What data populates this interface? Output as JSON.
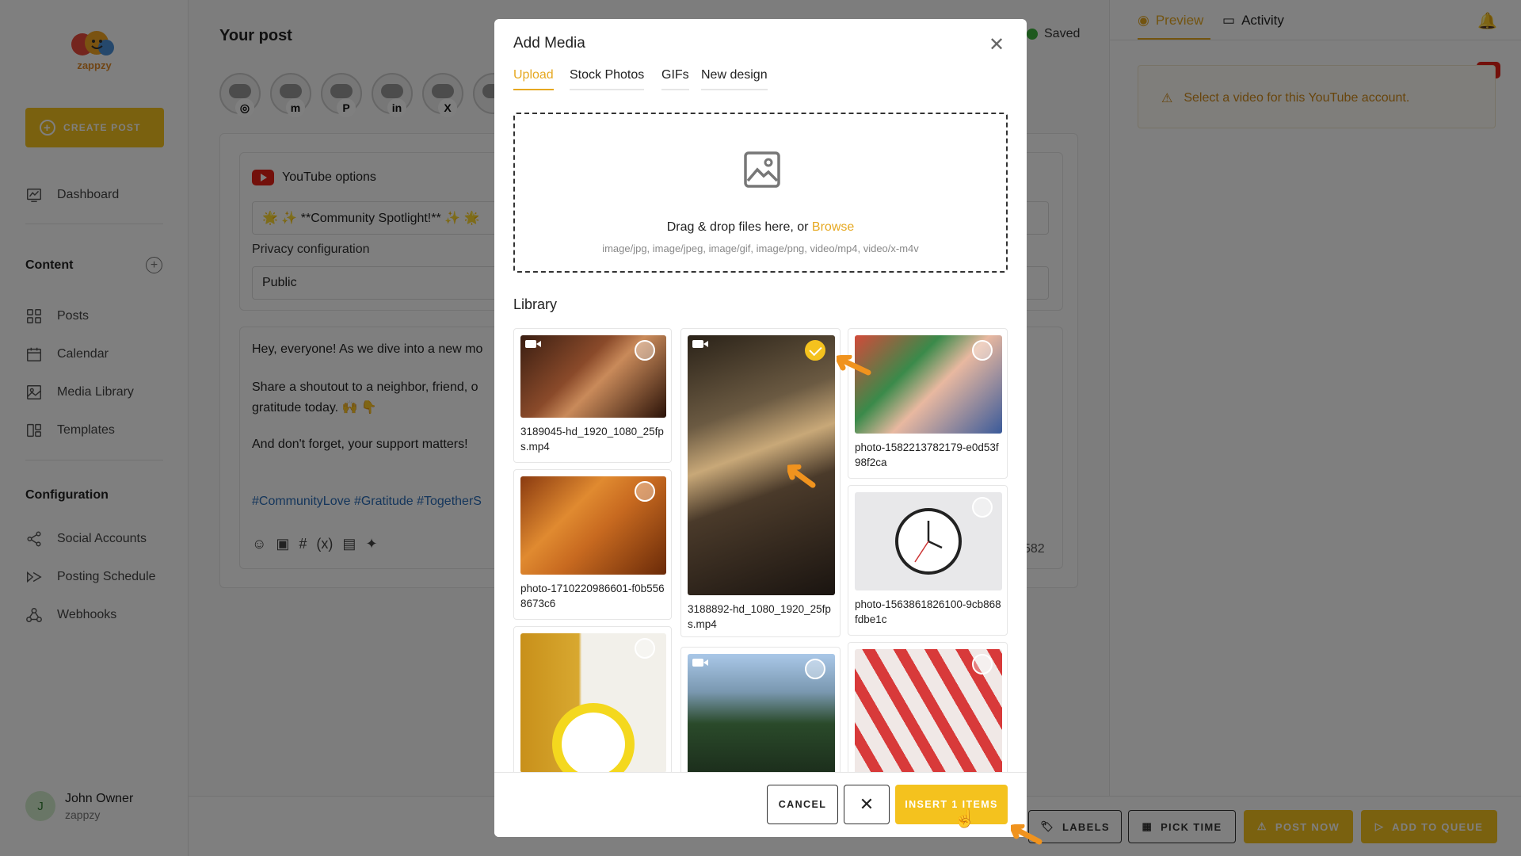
{
  "sidebar": {
    "logo_text": "zappzy",
    "create_post": "CREATE POST",
    "nav_top": [
      {
        "label": "Dashboard",
        "icon": "dashboard-icon"
      }
    ],
    "content_title": "Content",
    "content_items": [
      {
        "label": "Posts",
        "icon": "grid-icon"
      },
      {
        "label": "Calendar",
        "icon": "calendar-icon"
      },
      {
        "label": "Media Library",
        "icon": "image-icon"
      },
      {
        "label": "Templates",
        "icon": "template-icon"
      }
    ],
    "config_title": "Configuration",
    "config_items": [
      {
        "label": "Social Accounts",
        "icon": "share-icon"
      },
      {
        "label": "Posting Schedule",
        "icon": "schedule-icon"
      },
      {
        "label": "Webhooks",
        "icon": "webhook-icon"
      }
    ],
    "user": {
      "initial": "J",
      "name": "John Owner",
      "org": "zappzy"
    }
  },
  "main": {
    "title": "Your post",
    "saved": "Saved",
    "accounts": [
      {
        "network": "Instagram",
        "badge": "◎"
      },
      {
        "network": "Mastodon",
        "badge": "m"
      },
      {
        "network": "Pinterest",
        "badge": "P"
      },
      {
        "network": "LinkedIn",
        "badge": "in"
      },
      {
        "network": "X",
        "badge": "X"
      }
    ],
    "youtube_options": "YouTube options",
    "title_value": "🌟 ✨ **Community Spotlight!** ✨ 🌟",
    "privacy_label": "Privacy configuration",
    "privacy_value": "Public",
    "editor_lines": [
      "Hey, everyone! As we dive into a new mo",
      "Share a shoutout to a neighbor, friend, o",
      "gratitude today. 🙌 👇",
      "And don't forget, your support matters!"
    ],
    "hashtags": "#CommunityLove #Gratitude #TogetherS",
    "char_count": "582"
  },
  "right": {
    "tab_preview": "Preview",
    "tab_activity": "Activity",
    "warning": "Select a video for this YouTube account."
  },
  "bottom": {
    "labels": "LABELS",
    "pick_time": "PICK TIME",
    "post_now": "POST NOW",
    "add_to_queue": "ADD TO QUEUE"
  },
  "modal": {
    "title": "Add Media",
    "tabs": [
      "Upload",
      "Stock Photos",
      "GIFs",
      "New design"
    ],
    "active_tab": "Upload",
    "dropzone_text": "Drag & drop files here, or ",
    "browse": "Browse",
    "file_types": "image/jpg, image/jpeg, image/gif, image/png, video/mp4, video/x-m4v",
    "library_title": "Library",
    "items": [
      {
        "name": "3189045-hd_1920_1080_25fps.mp4",
        "type": "video",
        "selected": false
      },
      {
        "name": "3188892-hd_1080_1920_25fps.mp4",
        "type": "video",
        "selected": true
      },
      {
        "name": "photo-1582213782179-e0d53f98f2ca",
        "type": "image",
        "selected": false
      },
      {
        "name": "photo-1710220986601-f0b5568673c6",
        "type": "image",
        "selected": false
      },
      {
        "name": "photo-1563861826100-9cb868fdbe1c",
        "type": "image",
        "selected": false
      },
      {
        "name": "",
        "type": "image",
        "selected": false
      },
      {
        "name": "",
        "type": "image",
        "selected": false
      },
      {
        "name": "",
        "type": "image",
        "selected": false
      }
    ],
    "cancel": "CANCEL",
    "insert": "INSERT 1 ITEMS"
  },
  "colors": {
    "accent": "#f4c21e",
    "accent_text": "#e6a820",
    "youtube": "#e62117",
    "link": "#2a6db8"
  }
}
